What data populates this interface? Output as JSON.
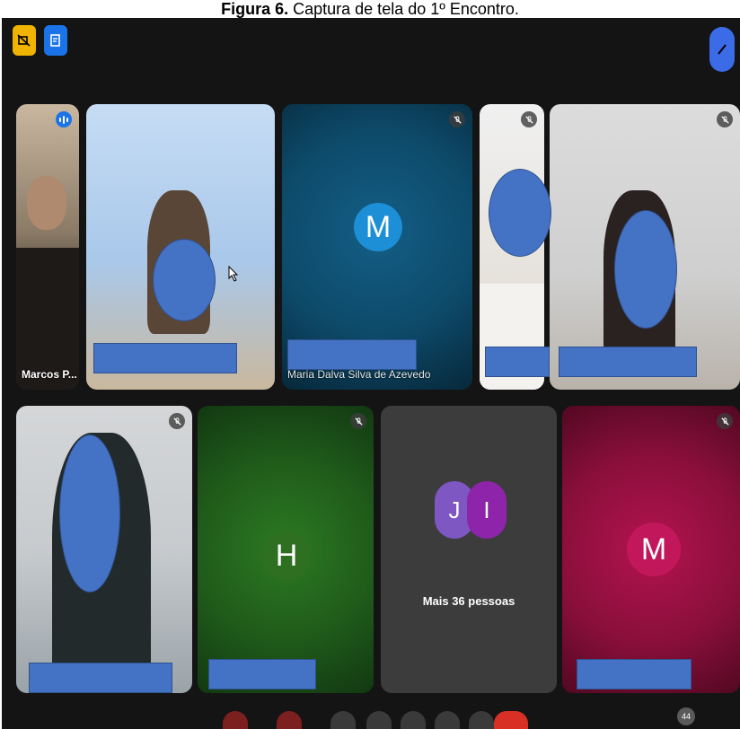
{
  "caption": {
    "bold": "Figura 6.",
    "text": " Captura de tela do 1º Encontro."
  },
  "participants": {
    "p1_name": "Marcos P...",
    "p3_initial": "M",
    "p3_name": "Maria Dalva Silva de Azevedo",
    "p7_initial": "H",
    "p8_initial_j": "J",
    "p8_initial_i": "I",
    "p8_label": "Mais 36 pessoas",
    "p9_initial": "M"
  },
  "controls": {
    "participant_count": "44"
  },
  "colors": {
    "app_bg": "#141414",
    "redaction": "#4472c4",
    "tile_teal": "#0d4a6a",
    "tile_green": "#1f5a1a",
    "tile_crimson": "#8a0f3a",
    "tile_gray": "#3c3c3c"
  }
}
